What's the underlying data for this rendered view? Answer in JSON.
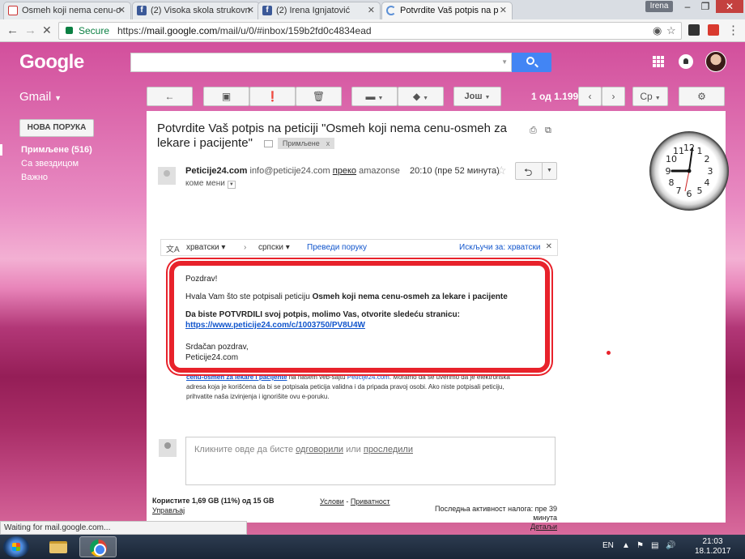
{
  "browser": {
    "tabs": [
      {
        "title": "Osmeh koji nema cenu-o",
        "icon": "gmail-envelope-icon"
      },
      {
        "title": "(2) Visoka skola strukovn",
        "icon": "facebook-icon"
      },
      {
        "title": "(2) Irena Ignjatović",
        "icon": "facebook-icon"
      },
      {
        "title": "Potvrdite Vaš potpis na p",
        "icon": "loading-spinner-icon"
      }
    ],
    "profile_name": "Irena",
    "secure_label": "Secure",
    "url_prefix": "https://",
    "url_host": "mail.google.com",
    "url_path": "/mail/u/0/#inbox/159b2fd0c4834ead",
    "status_text": "Waiting for mail.google.com..."
  },
  "gmail": {
    "logo": "Google",
    "app_label": "Gmail",
    "toolbar": {
      "more_label": "Још",
      "pager": "1 од 1.199",
      "lang_label": "Ср"
    },
    "compose_label": "НОВА ПОРУКА",
    "sidebar": {
      "items": [
        {
          "label": "Примљене (516)"
        },
        {
          "label": "Са звездицом"
        },
        {
          "label": "Важно"
        }
      ]
    },
    "message": {
      "subject": "Potvrdite Vaš potpis na peticiji \"Osmeh koji nema cenu-osmeh za lekare i pacijente\"",
      "label_chip": "Примљене",
      "label_chip_x": "x",
      "sender_name": "Peticije24.com",
      "sender_email": "info@peticije24.com",
      "via_label": "преко",
      "via_domain": "amazonse",
      "to_me": "коме мени",
      "time": "20:10 (пре 52 минута)",
      "translate": {
        "from_lang": "хрватски",
        "arrow": "›",
        "to_lang": "српски",
        "action": "Преведи поруку",
        "turn_off": "Искључи за: хрватски"
      },
      "body": {
        "greeting": "Pozdrav!",
        "thanks_prefix": "Hvala Vam što ste potpisali peticiju",
        "petition_title": "Osmeh koji nema cenu-osmeh za lekare i pacijente",
        "confirm_text": "Da biste POTVRDILI svoj potpis, molimo Vas, otvorite sledeću stranicu:",
        "confirm_link": "https://www.peticije24.com/c/1003750/PV8U4W",
        "signoff": "Srdačan pozdrav,",
        "signature": "Peticije24.com"
      },
      "behind_text": {
        "link1": "cenu-osmeh za lekare i pacijente",
        "part1": "na našem veb-sajtu",
        "link2": "Peticije24.com",
        "part2": ". Moramo da se uverimo da je elektronska adresa koja je korišćena da bi se potpisala peticija validna i da pripada pravoj osobi. Ako niste potpisali peticiju, prihvatite naša izvinjenja i ignorišite ovu e-poruku."
      },
      "reply_placeholder_prefix": "Кликните овде да бисте",
      "reply_link": "одговорили",
      "reply_or": "или",
      "forward_link": "проследили"
    },
    "footer": {
      "storage": "Користите 1,69 GB (11%) од 15 GB",
      "manage": "Управљај",
      "terms": "Услови",
      "dash": "-",
      "privacy": "Приватност",
      "last_activity": "Последња активност налога: пре 39 минута",
      "details": "Детаљи"
    }
  },
  "gadget": {
    "clock_time": "9:03"
  },
  "taskbar": {
    "language": "EN",
    "time": "21:03",
    "date": "18.1.2017"
  },
  "colors": {
    "gmail_blue": "#4285f4",
    "highlight_red": "#e8222b",
    "link_blue": "#1155cc"
  }
}
